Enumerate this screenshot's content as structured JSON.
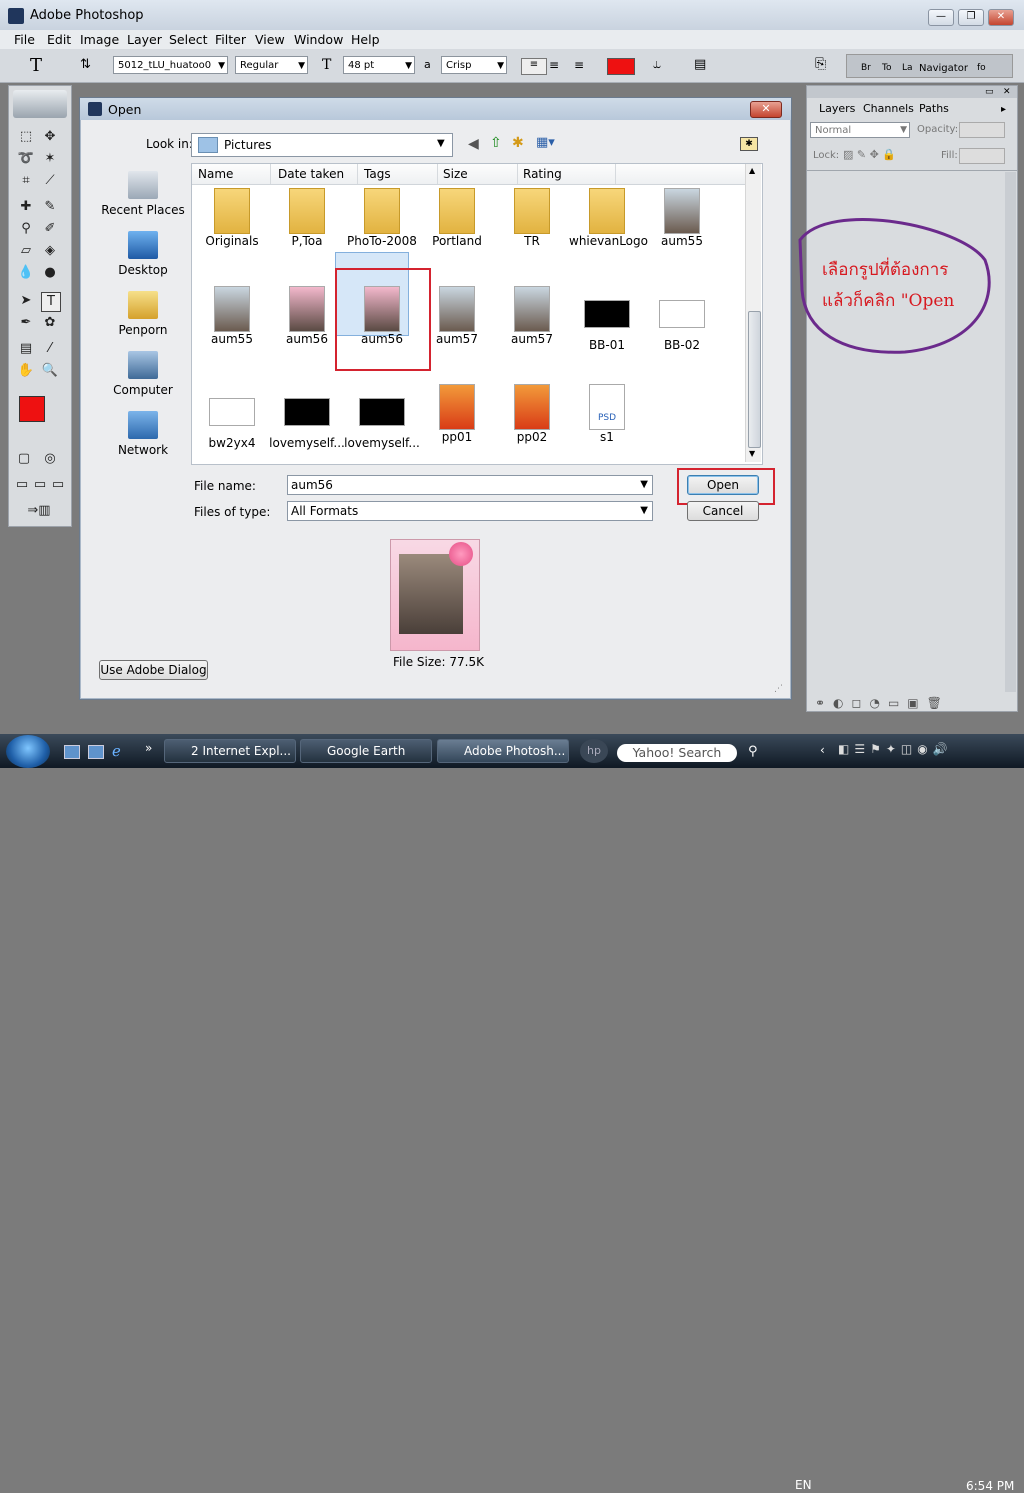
{
  "app": {
    "title": "Adobe Photoshop"
  },
  "menubar": [
    "File",
    "Edit",
    "Image",
    "Layer",
    "Select",
    "Filter",
    "View",
    "Window",
    "Help"
  ],
  "options_bar": {
    "font_family": "5012_tLU_huatoo0",
    "font_style": "Regular",
    "font_size": "48 pt",
    "anti_alias_label": "a",
    "anti_alias": "Crisp",
    "text_color": "#ee1111"
  },
  "dock_tabs": [
    "Br",
    "To",
    "La",
    "Navigator",
    "fo"
  ],
  "layers_panel": {
    "tabs": [
      "Layers",
      "Channels",
      "Paths"
    ],
    "blend_mode": "Normal",
    "opacity_label": "Opacity:",
    "lock_label": "Lock:",
    "fill_label": "Fill:"
  },
  "dialog": {
    "title": "Open",
    "look_in_label": "Look in:",
    "look_in_value": "Pictures",
    "places": [
      "Recent Places",
      "Desktop",
      "Penporn",
      "Computer",
      "Network"
    ],
    "columns": [
      "Name",
      "Date taken",
      "Tags",
      "Size",
      "Rating"
    ],
    "files_row1": [
      "Originals",
      "P,Toa",
      "PhoTo-2008",
      "Portland",
      "TR",
      "whievanLogo",
      "aum55"
    ],
    "files_row2": [
      "aum55",
      "aum56",
      "aum56",
      "aum57",
      "aum57",
      "BB-01",
      "BB-02"
    ],
    "files_row3": [
      "bw2yx4",
      "lovemyself...",
      "lovemyself...",
      "pp01",
      "pp02",
      "s1"
    ],
    "selected_file": "aum56",
    "file_name_label": "File name:",
    "file_name_value": "aum56",
    "files_of_type_label": "Files of type:",
    "files_of_type_value": "All Formats",
    "open_button": "Open",
    "cancel_button": "Cancel",
    "use_adobe_dialog": "Use Adobe Dialog",
    "file_size": "File Size: 77.5K",
    "psd_badge": "PSD"
  },
  "annotation": {
    "line1": "เลือกรูปที่ต้องการ",
    "line2": "แล้วก็คลิก  \"Open",
    "color": "#d71920",
    "arrow_color": "#3b69d8",
    "circle_color": "#6b2a8c"
  },
  "taskbar": {
    "tasks": [
      "2 Internet Expl...",
      "Google Earth",
      "Adobe Photosh..."
    ],
    "search": "Yahoo! Search",
    "language": "EN",
    "time": "6:54 PM"
  }
}
